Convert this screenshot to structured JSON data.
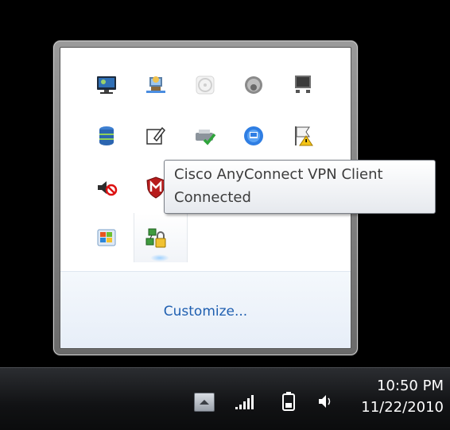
{
  "flyout": {
    "customize_label": "Customize...",
    "icons": [
      "monitor-network-icon",
      "network-user-icon",
      "disc-icon",
      "device-dome-icon",
      "display-device-icon",
      "database-icon",
      "notepad-pen-icon",
      "printer-check-icon",
      "blue-circle-app-icon",
      "action-center-flag-icon",
      "muted-speaker-icon",
      "mcafee-shield-icon",
      "windows-update-icon",
      "cisco-anyconnect-vpn-icon"
    ]
  },
  "tooltip": {
    "title": "Cisco AnyConnect VPN Client",
    "status": "Connected"
  },
  "taskbar": {
    "time": "10:50 PM",
    "date": "11/22/2010",
    "tray_icons": [
      "show-hidden-icons-icon",
      "signal-strength-icon",
      "battery-icon",
      "volume-icon"
    ]
  }
}
